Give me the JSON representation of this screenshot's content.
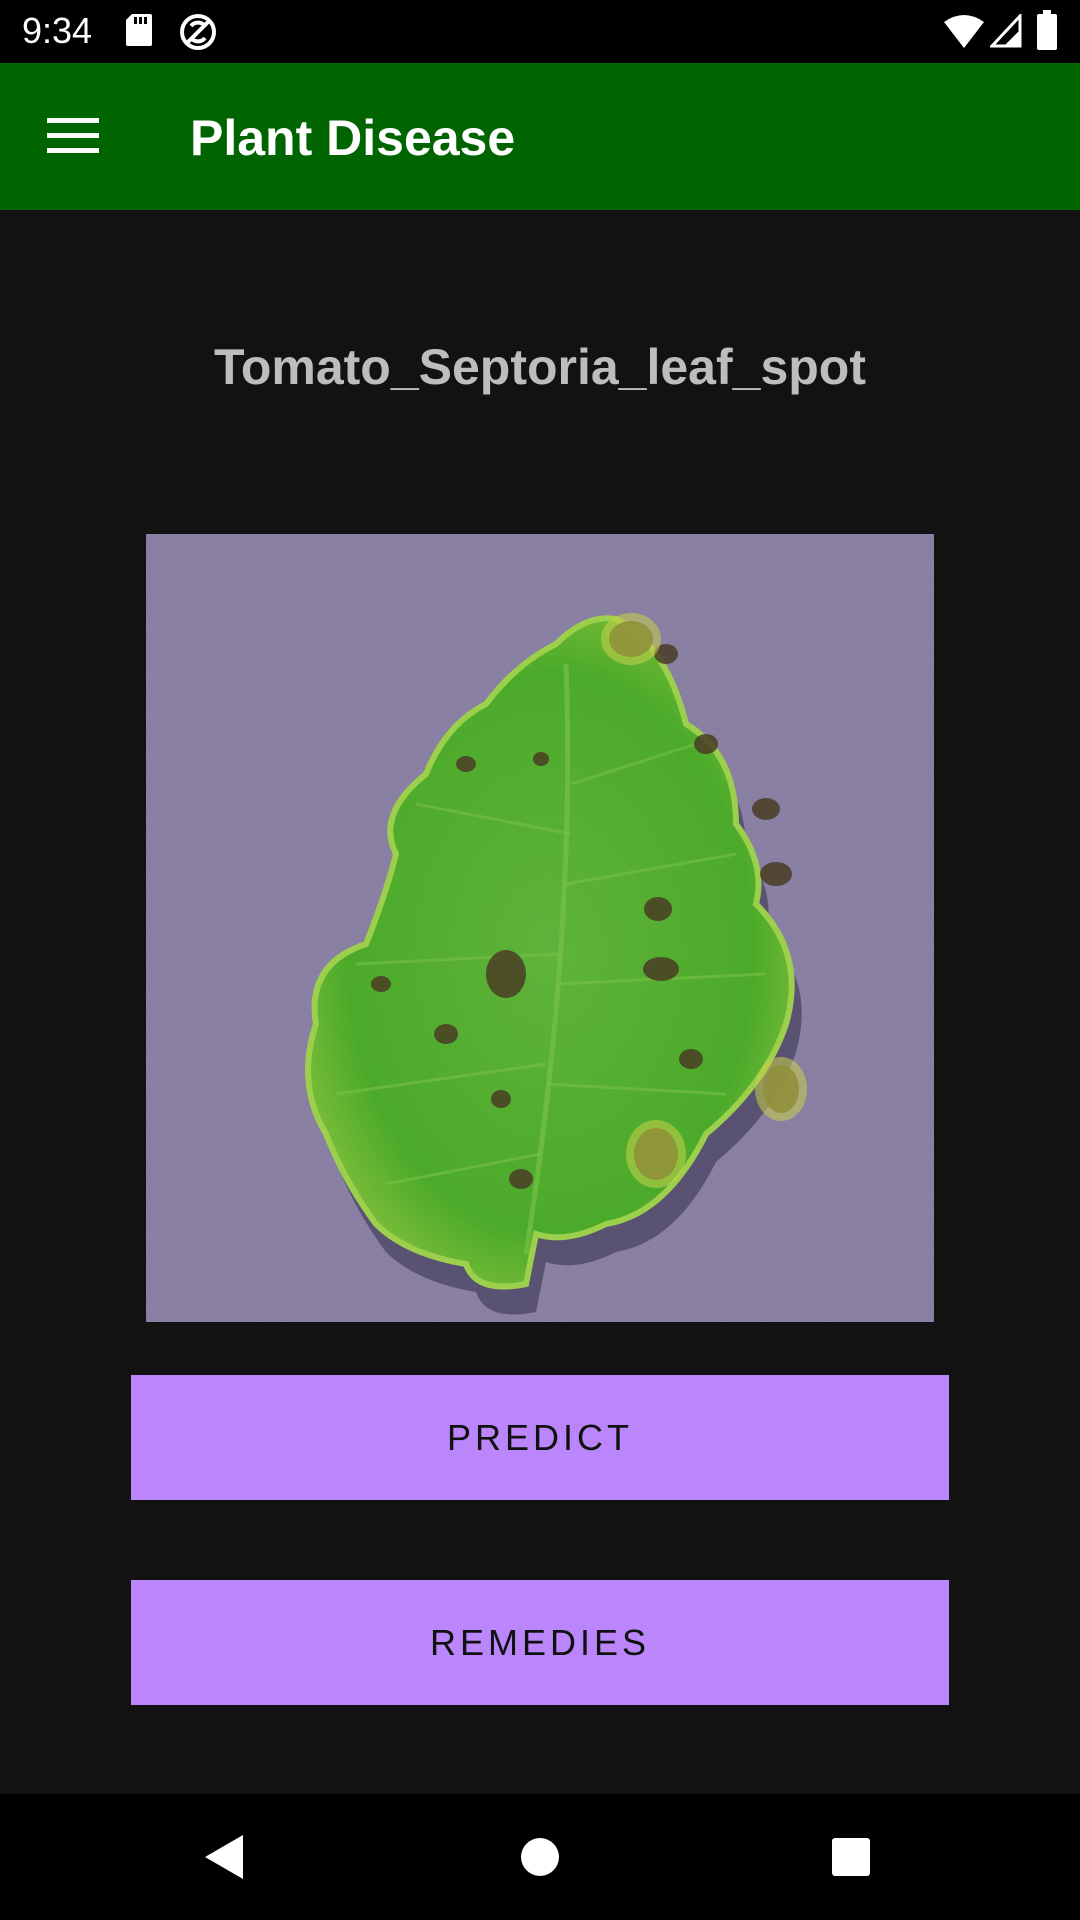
{
  "status_bar": {
    "time": "9:34",
    "icons": [
      "sd-card-icon",
      "sync-icon",
      "wifi-icon",
      "signal-icon",
      "battery-icon"
    ]
  },
  "app_bar": {
    "title": "Plant Disease",
    "menu_icon": "hamburger-menu-icon",
    "background_color": "#006400"
  },
  "main": {
    "disease_name": "Tomato_Septoria_leaf_spot",
    "image_subject": "leaf-image",
    "predict_label": "PREDICT",
    "remedies_label": "REMEDIES",
    "button_color": "#bb86fc"
  },
  "nav_bar": {
    "icons": [
      "back-icon",
      "home-icon",
      "recents-icon"
    ]
  }
}
